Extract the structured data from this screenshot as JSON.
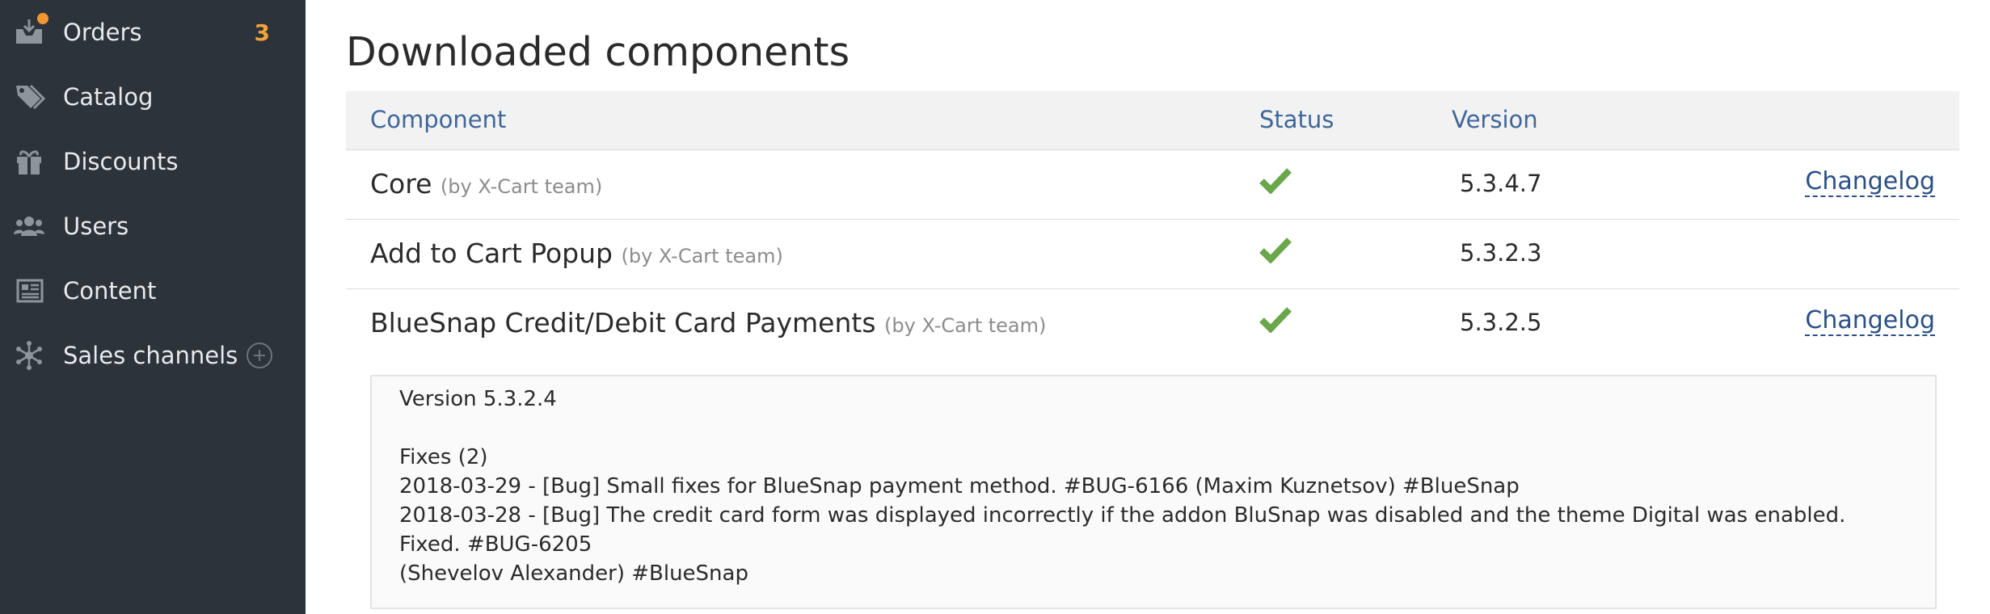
{
  "sidebar": {
    "items": [
      {
        "label": "Orders",
        "icon": "orders-icon",
        "badge": "3"
      },
      {
        "label": "Catalog",
        "icon": "tags-icon"
      },
      {
        "label": "Discounts",
        "icon": "gift-icon"
      },
      {
        "label": "Users",
        "icon": "users-icon"
      },
      {
        "label": "Content",
        "icon": "content-icon"
      },
      {
        "label": "Sales channels",
        "icon": "network-icon"
      }
    ]
  },
  "page": {
    "title": "Downloaded components"
  },
  "table": {
    "headers": {
      "component": "Component",
      "status": "Status",
      "version": "Version"
    },
    "rows": [
      {
        "name": "Core",
        "author": "(by X-Cart team)",
        "status": "check-icon",
        "version": "5.3.4.7",
        "changelog": "Changelog"
      },
      {
        "name": "Add to Cart Popup",
        "author": "(by X-Cart team)",
        "status": "check-icon",
        "version": "5.3.2.3",
        "changelog": ""
      },
      {
        "name": "BlueSnap Credit/Debit Card Payments",
        "author": "(by X-Cart team)",
        "status": "check-icon",
        "version": "5.3.2.5",
        "changelog": "Changelog"
      }
    ]
  },
  "changelog_box": {
    "version": "Version 5.3.2.4",
    "section": "Fixes (2)",
    "lines": [
      "2018-03-29 - [Bug] Small fixes for BlueSnap payment method. #BUG-6166 (Maxim Kuznetsov) #BlueSnap",
      "2018-03-28 - [Bug] The credit card form was displayed incorrectly if the addon BluSnap was disabled and the theme Digital was enabled. Fixed. #BUG-6205",
      "(Shevelov Alexander) #BlueSnap"
    ]
  },
  "colors": {
    "sidebar_bg": "#2d333b",
    "badge": "#f2a33a",
    "check": "#6aa64a",
    "link": "#2a4f86",
    "header_text": "#3e6799"
  }
}
